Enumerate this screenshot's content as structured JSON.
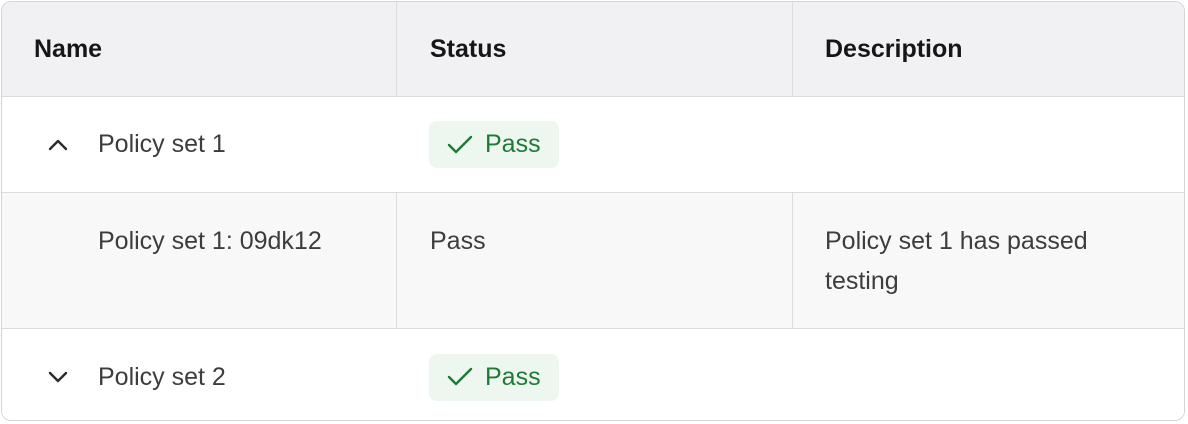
{
  "table": {
    "columns": [
      "Name",
      "Status",
      "Description"
    ],
    "rows": [
      {
        "type": "group",
        "name": "Policy set 1",
        "expanded": true,
        "chevron_icon": "chevron-up-icon",
        "status": "Pass",
        "status_icon": "checkmark-icon",
        "description": ""
      },
      {
        "type": "child",
        "name": "Policy set 1: 09dk12",
        "status": "Pass",
        "description": "Policy set 1 has passed testing"
      },
      {
        "type": "group",
        "name": "Policy set 2",
        "expanded": false,
        "chevron_icon": "chevron-down-icon",
        "status": "Pass",
        "status_icon": "checkmark-icon",
        "description": ""
      }
    ]
  },
  "colors": {
    "header_bg": "#f1f1f3",
    "child_row_bg": "#f8f8f9",
    "badge_bg": "#edf7ef",
    "badge_text": "#1e7b34",
    "border": "#dcdcdf"
  }
}
